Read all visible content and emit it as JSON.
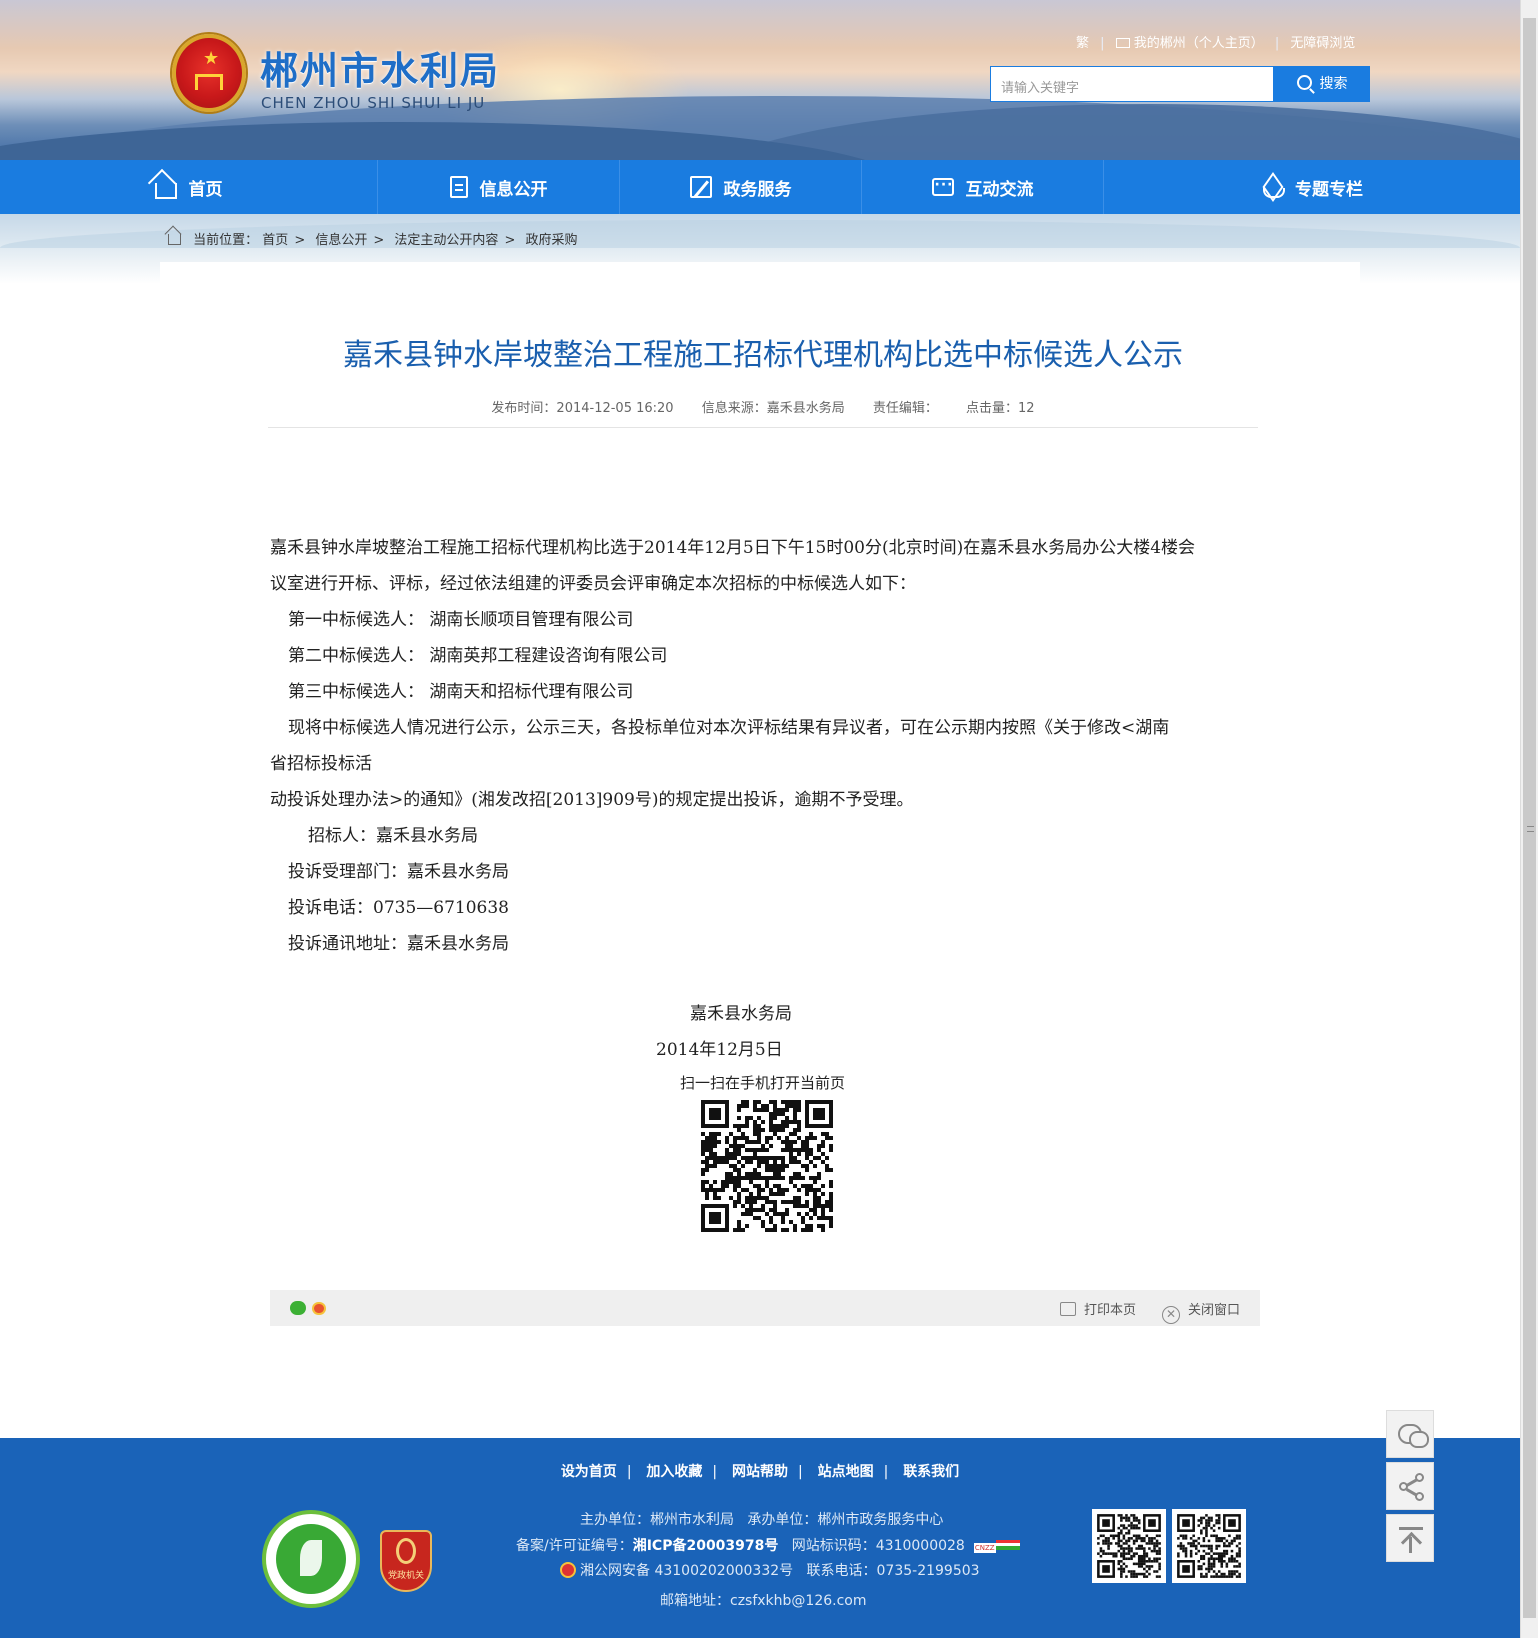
{
  "header": {
    "site_title": "郴州市水利局",
    "site_subtitle": "CHEN ZHOU SHI SHUI LI JU",
    "top_links": [
      "繁",
      "我的郴州（个人主页）",
      "无障碍浏览"
    ],
    "search_placeholder": "请输入关键字",
    "search_button": "搜索"
  },
  "nav": {
    "items": [
      {
        "label": "首页",
        "icon": "home-icon"
      },
      {
        "label": "信息公开",
        "icon": "document-icon"
      },
      {
        "label": "政务服务",
        "icon": "edit-icon"
      },
      {
        "label": "互动交流",
        "icon": "chat-icon"
      },
      {
        "label": "专题专栏",
        "icon": "layers-icon"
      }
    ]
  },
  "breadcrumb": {
    "prefix": "当前位置：",
    "items": [
      "首页",
      "信息公开",
      "法定主动公开内容",
      "政府采购"
    ]
  },
  "article": {
    "title": "嘉禾县钟水岸坡整治工程施工招标代理机构比选中标候选人公示",
    "meta": {
      "publish_time": "发布时间：2014-12-05 16:20",
      "source": "信息来源：嘉禾县水务局",
      "editor": "责任编辑：",
      "clicks": "点击量：12"
    },
    "paragraphs": [
      "嘉禾县钟水岸坡整治工程施工招标代理机构比选于2014年12月5日下午15时00分(北京时间)在嘉禾县水务局办公大楼4楼会",
      "议室进行开标、评标，经过依法组建的评委员会评审确定本次招标的中标候选人如下：",
      "第一中标候选人：  湖南长顺项目管理有限公司",
      "第二中标候选人：  湖南英邦工程建设咨询有限公司",
      "第三中标候选人：  湖南天和招标代理有限公司",
      "现将中标候选人情况进行公示，公示三天，各投标单位对本次评标结果有异议者，可在公示期内按照《关于修改<湖南",
      "省招标投标活",
      "动投诉处理办法>的通知》(湘发改招[2013]909号)的规定提出投诉，逾期不予受理。",
      "招标人：嘉禾县水务局",
      "投诉受理部门：嘉禾县水务局",
      "投诉电话：0735—6710638",
      "投诉通讯地址：嘉禾县水务局"
    ],
    "signature": "嘉禾县水务局",
    "date": "2014年12月5日",
    "qr_label": "扫一扫在手机打开当前页"
  },
  "share_bar": {
    "print": "打印本页",
    "close": "关闭窗口"
  },
  "footer": {
    "links": [
      "设为首页",
      "加入收藏",
      "网站帮助",
      "站点地图",
      "联系我们"
    ],
    "sponsor": "主办单位：郴州市水利局",
    "organizer": "承办单位：郴州市政务服务中心",
    "icp_label": "备案/许可证编号：",
    "icp_value": "湘ICP备20003978号",
    "site_code": "网站标识码：4310000028",
    "police": "湘公网安备 43100202000332号",
    "phone": "联系电话：0735-2199503",
    "email": "邮箱地址：czsfxkhb@126.com",
    "badge_party": "党政机关"
  },
  "colors": {
    "brand_blue": "#1a7ce0",
    "title_blue": "#1a5fae",
    "footer_blue": "#1a63b8"
  }
}
